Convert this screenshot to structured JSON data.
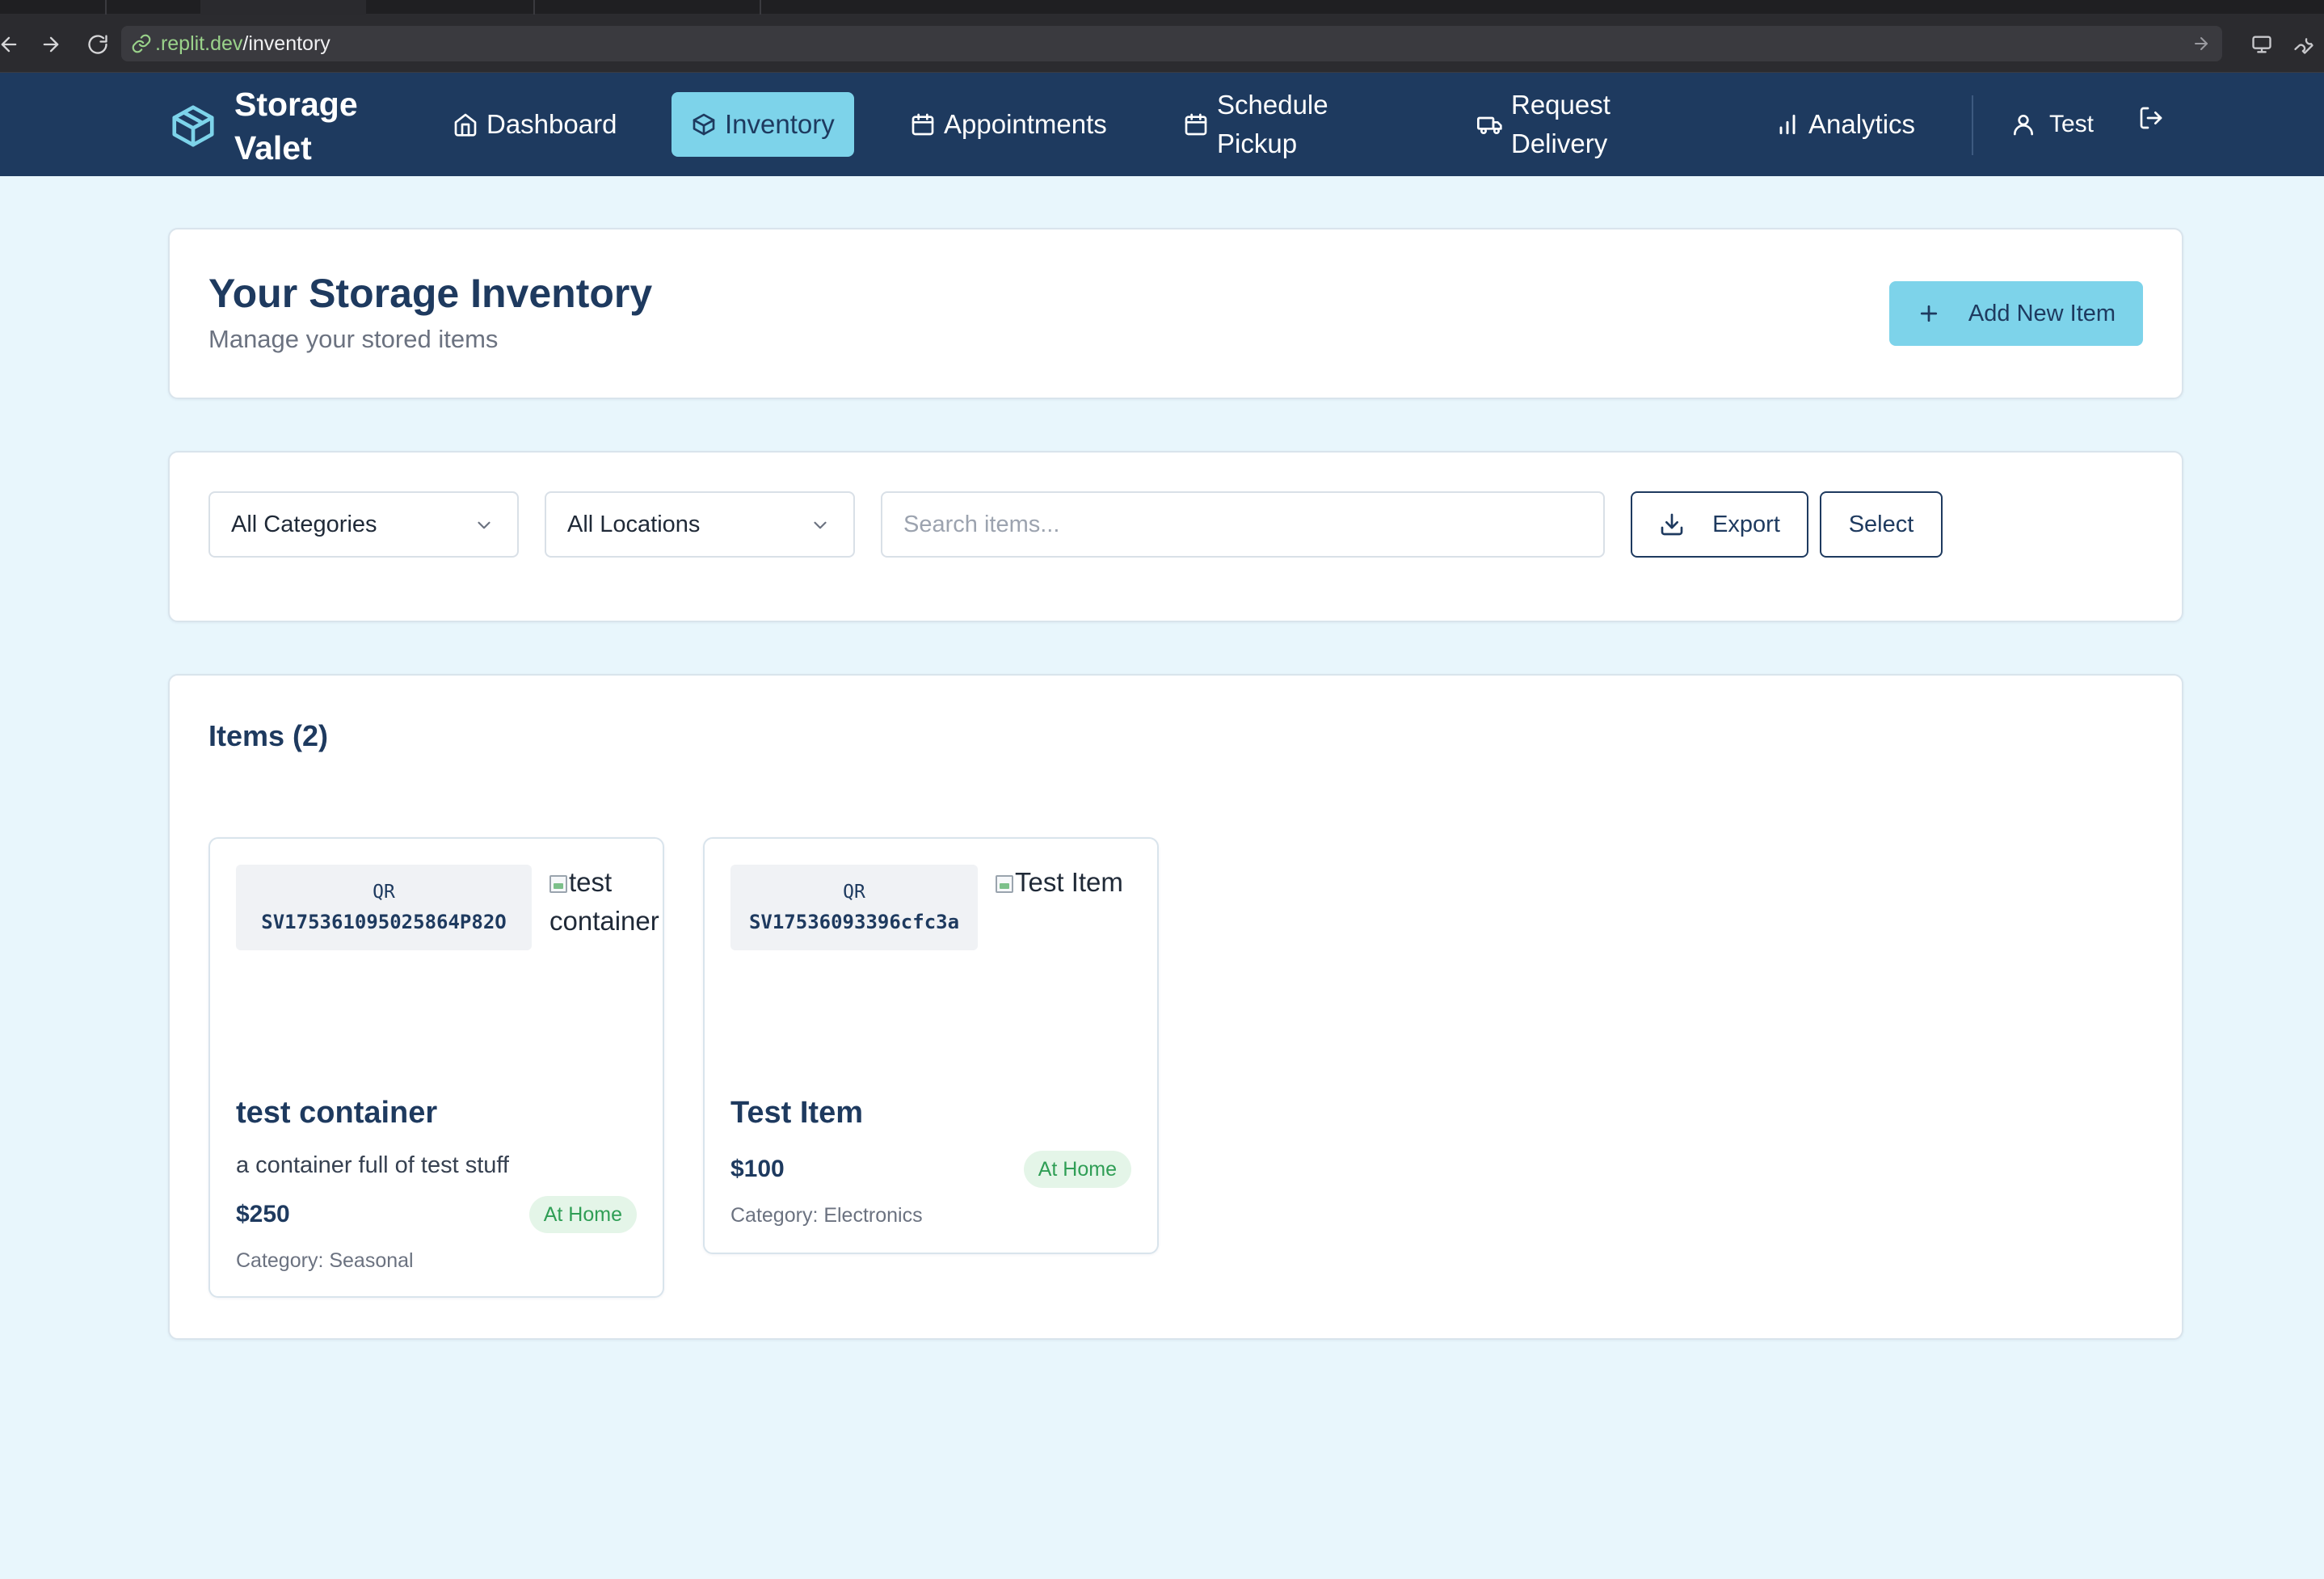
{
  "browser": {
    "url_host": ".replit.dev",
    "url_path": "/inventory"
  },
  "app": {
    "brand_name": "Storage Valet",
    "nav": [
      {
        "label": "Dashboard",
        "icon": "home-icon",
        "active": false
      },
      {
        "label": "Inventory",
        "icon": "package-icon",
        "active": true
      },
      {
        "label": "Appointments",
        "icon": "calendar-icon",
        "active": false
      },
      {
        "label": "Schedule Pickup",
        "icon": "calendar-icon",
        "active": false
      },
      {
        "label": "Request Delivery",
        "icon": "truck-icon",
        "active": false
      },
      {
        "label": "Analytics",
        "icon": "bar-chart-icon",
        "active": false
      }
    ],
    "user_name": "Test",
    "colors": {
      "header_bg": "#1e3a5f",
      "accent": "#7dd3ea",
      "page_bg": "#e8f6fc",
      "status_green": "#2f9e55"
    }
  },
  "page": {
    "title": "Your Storage Inventory",
    "subtitle": "Manage your stored items",
    "add_button_label": "Add New Item"
  },
  "filters": {
    "category_selected": "All Categories",
    "location_selected": "All Locations",
    "search_placeholder": "Search items...",
    "search_value": "",
    "export_label": "Export",
    "select_label": "Select"
  },
  "items_section": {
    "title": "Items (2)"
  },
  "items": [
    {
      "qr_label": "QR",
      "qr_code": "SV175361095025864P82O",
      "image_alt": "test container",
      "name": "test container",
      "description": "a container full of test stuff",
      "price": "$250",
      "status": "At Home",
      "category": "Category: Seasonal"
    },
    {
      "qr_label": "QR",
      "qr_code": "SV17536093396cfc3a",
      "image_alt": "Test Item",
      "name": "Test Item",
      "description": "",
      "price": "$100",
      "status": "At Home",
      "category": "Category: Electronics"
    }
  ]
}
